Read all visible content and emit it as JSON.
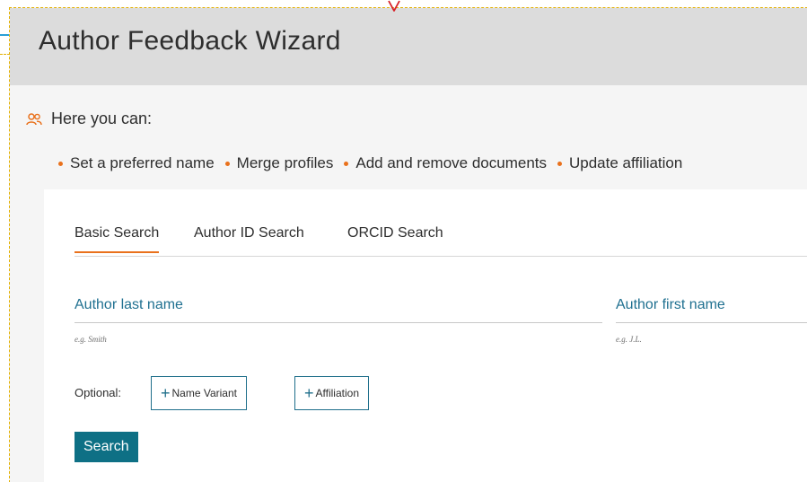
{
  "header": {
    "title": "Author Feedback Wizard"
  },
  "intro": {
    "title": "Here you can:",
    "features": [
      "Set a preferred name",
      "Merge profiles",
      "Add and remove documents",
      "Update affiliation"
    ]
  },
  "tabs": [
    {
      "label": "Basic Search",
      "active": true
    },
    {
      "label": "Author ID Search",
      "active": false
    },
    {
      "label": "ORCID Search",
      "active": false
    }
  ],
  "form": {
    "last_name": {
      "label": "Author last name",
      "value": "",
      "hint": "e.g. Smith"
    },
    "first_name": {
      "label": "Author first name",
      "value": "",
      "hint": "e.g. J.L."
    },
    "optional_label": "Optional:",
    "name_variant_label": "Name Variant",
    "affiliation_label": "Affiliation",
    "search_label": "Search"
  },
  "colors": {
    "accent": "#e9711c",
    "primary": "#0e7085",
    "label": "#1f7090",
    "header_bg": "#dcdcdc",
    "page_bg": "#f5f5f5"
  },
  "icons": {
    "intro": "users-icon",
    "add": "plus-icon",
    "marker": "dropdown-marker-icon"
  }
}
